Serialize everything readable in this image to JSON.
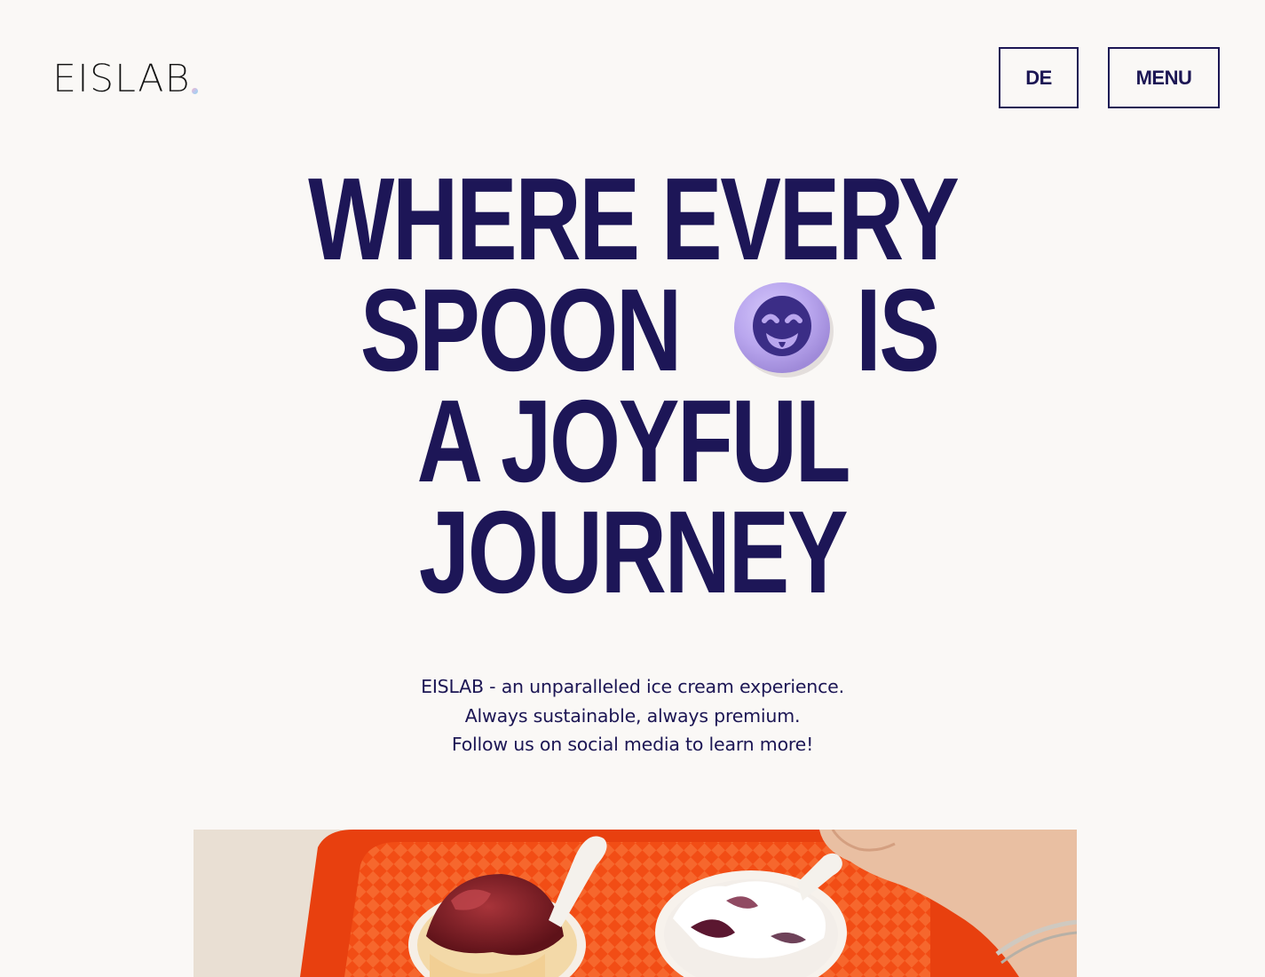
{
  "header": {
    "logo_text": "EISLAB",
    "lang_button": "DE",
    "menu_button": "MENU"
  },
  "hero": {
    "headline_lines": [
      "WHERE EVERY",
      "SPOON",
      "IS",
      "A JOYFUL",
      "JOURNEY"
    ],
    "tagline_lines": [
      "EISLAB - an unparalleled ice cream experience.",
      "Always sustainable, always premium.",
      "Follow us on social media to learn more!"
    ]
  },
  "icons": {
    "scoop": "smiling-ice-cream-scoop-icon"
  },
  "colors": {
    "background": "#faf8f6",
    "brand_navy": "#1d1657",
    "scoop_lavender": "#b9a6ee",
    "tray_orange": "#ef4a14"
  }
}
